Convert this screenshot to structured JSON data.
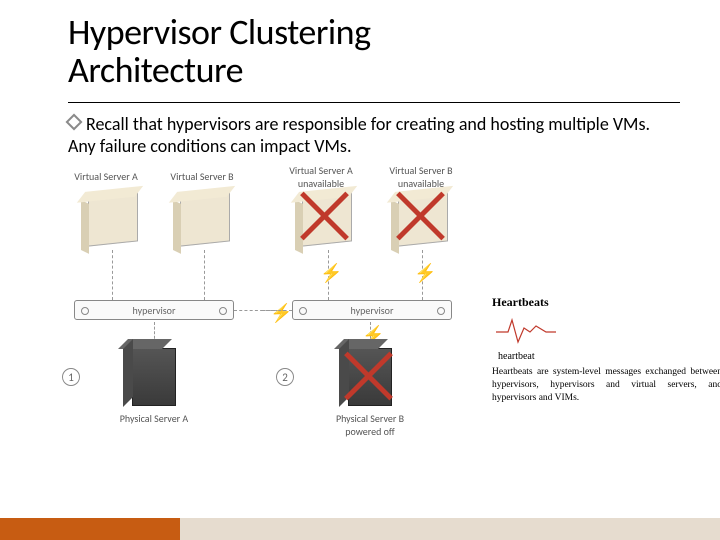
{
  "title": {
    "line1": "Hypervisor Clustering",
    "line2": "Architecture"
  },
  "body": {
    "bullet1": "Recall that hypervisors are responsible for creating and hosting multiple VMs. Any failure conditions can impact VMs."
  },
  "panel1": {
    "num": "1",
    "vmA": "Virtual Server A",
    "vmB": "Virtual Server B",
    "hypervisor": "hypervisor",
    "physical": "Physical Server A"
  },
  "panel2": {
    "num": "2",
    "vmA": "Virtual Server A unavailable",
    "vmB": "Virtual Server B unavailable",
    "hypervisor": "hypervisor",
    "physical": "Physical Server B powered off"
  },
  "heartbeat": {
    "title": "Heartbeats",
    "caption": "heartbeat",
    "desc": "Heartbeats are system-level messages exchanged between hypervisors, hypervisors and virtual servers, and hypervisors and VIMs."
  }
}
